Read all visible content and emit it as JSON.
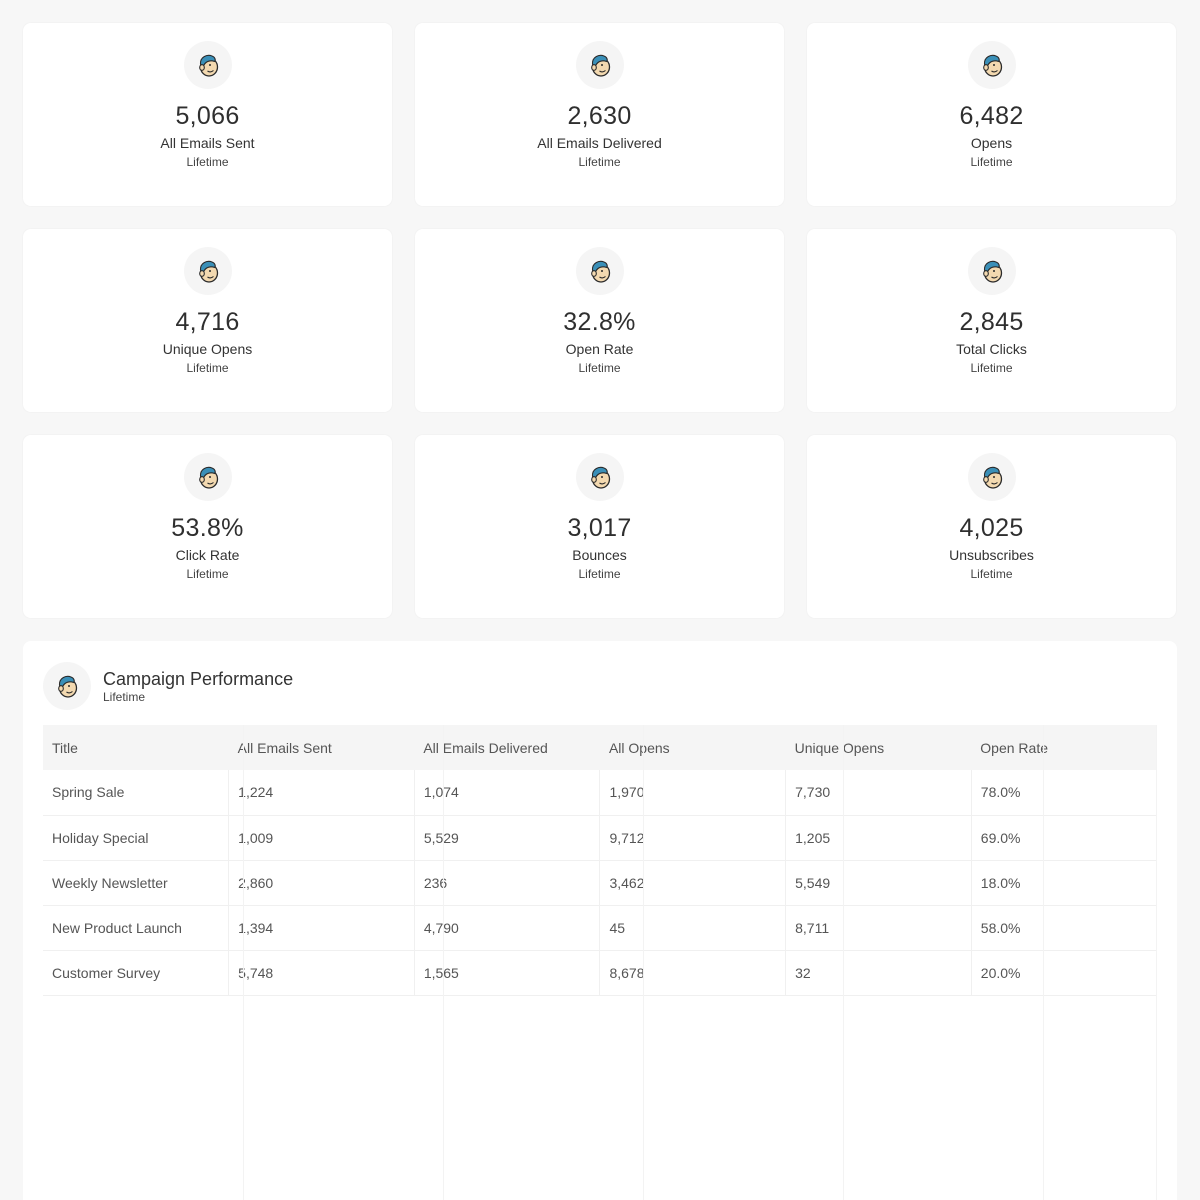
{
  "metrics": [
    {
      "value": "5,066",
      "label": "All Emails Sent",
      "period": "Lifetime"
    },
    {
      "value": "2,630",
      "label": "All Emails Delivered",
      "period": "Lifetime"
    },
    {
      "value": "6,482",
      "label": "Opens",
      "period": "Lifetime"
    },
    {
      "value": "4,716",
      "label": "Unique Opens",
      "period": "Lifetime"
    },
    {
      "value": "32.8%",
      "label": "Open Rate",
      "period": "Lifetime"
    },
    {
      "value": "2,845",
      "label": "Total Clicks",
      "period": "Lifetime"
    },
    {
      "value": "53.8%",
      "label": "Click Rate",
      "period": "Lifetime"
    },
    {
      "value": "3,017",
      "label": "Bounces",
      "period": "Lifetime"
    },
    {
      "value": "4,025",
      "label": "Unsubscribes",
      "period": "Lifetime"
    }
  ],
  "icon": "mailchimp-logo-icon",
  "campaign": {
    "title": "Campaign Performance",
    "period": "Lifetime",
    "columns": [
      "Title",
      "All Emails Sent",
      "All Emails Delivered",
      "All Opens",
      "Unique Opens",
      "Open Rate"
    ],
    "rows": [
      [
        "Spring Sale",
        "1,224",
        "1,074",
        "1,970",
        "7,730",
        "78.0%"
      ],
      [
        "Holiday Special",
        "1,009",
        "5,529",
        "9,712",
        "1,205",
        "69.0%"
      ],
      [
        "Weekly Newsletter",
        "2,860",
        "236",
        "3,462",
        "5,549",
        "18.0%"
      ],
      [
        "New Product Launch",
        "1,394",
        "4,790",
        "45",
        "8,711",
        "58.0%"
      ],
      [
        "Customer Survey",
        "5,748",
        "1,565",
        "8,678",
        "32",
        "20.0%"
      ]
    ]
  }
}
